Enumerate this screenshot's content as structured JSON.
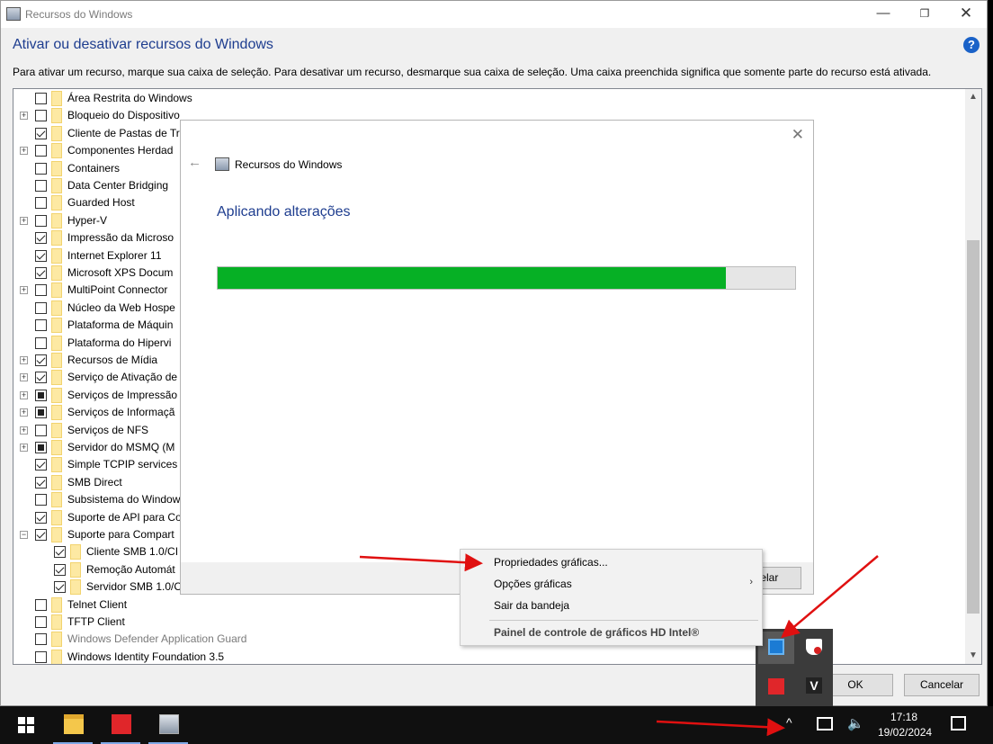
{
  "window": {
    "title": "Recursos do Windows",
    "minimize_glyph": "—",
    "maximize_glyph": "❐",
    "close_glyph": "✕"
  },
  "main": {
    "heading": "Ativar ou desativar recursos do Windows",
    "help_glyph": "?",
    "instructions": "Para ativar um recurso, marque sua caixa de seleção. Para desativar um recurso, desmarque sua caixa de seleção. Uma caixa preenchida significa que somente parte do recurso está ativada.",
    "features": [
      {
        "label": "Área Restrita do Windows",
        "state": "unchecked",
        "expandable": false,
        "indent": 0,
        "disabled": false
      },
      {
        "label": "Bloqueio do Dispositivo",
        "state": "unchecked",
        "expandable": true,
        "indent": 0,
        "disabled": false
      },
      {
        "label": "Cliente de Pastas de Tr",
        "state": "checked",
        "expandable": false,
        "indent": 0,
        "disabled": false
      },
      {
        "label": "Componentes Herdad",
        "state": "unchecked",
        "expandable": true,
        "indent": 0,
        "disabled": false
      },
      {
        "label": "Containers",
        "state": "unchecked",
        "expandable": false,
        "indent": 0,
        "disabled": false
      },
      {
        "label": "Data Center Bridging",
        "state": "unchecked",
        "expandable": false,
        "indent": 0,
        "disabled": false
      },
      {
        "label": "Guarded Host",
        "state": "unchecked",
        "expandable": false,
        "indent": 0,
        "disabled": false
      },
      {
        "label": "Hyper-V",
        "state": "unchecked",
        "expandable": true,
        "indent": 0,
        "disabled": false
      },
      {
        "label": "Impressão da Microso",
        "state": "checked",
        "expandable": false,
        "indent": 0,
        "disabled": false
      },
      {
        "label": "Internet Explorer 11",
        "state": "checked",
        "expandable": false,
        "indent": 0,
        "disabled": false
      },
      {
        "label": "Microsoft XPS Docum",
        "state": "checked",
        "expandable": false,
        "indent": 0,
        "disabled": false
      },
      {
        "label": "MultiPoint Connector",
        "state": "unchecked",
        "expandable": true,
        "indent": 0,
        "disabled": false
      },
      {
        "label": "Núcleo da Web Hospe",
        "state": "unchecked",
        "expandable": false,
        "indent": 0,
        "disabled": false
      },
      {
        "label": "Plataforma de Máquin",
        "state": "unchecked",
        "expandable": false,
        "indent": 0,
        "disabled": false
      },
      {
        "label": "Plataforma do Hipervi",
        "state": "unchecked",
        "expandable": false,
        "indent": 0,
        "disabled": false
      },
      {
        "label": "Recursos de Mídia",
        "state": "checked",
        "expandable": true,
        "indent": 0,
        "disabled": false
      },
      {
        "label": "Serviço de Ativação de",
        "state": "checked",
        "expandable": true,
        "indent": 0,
        "disabled": false
      },
      {
        "label": "Serviços de Impressão",
        "state": "partial",
        "expandable": true,
        "indent": 0,
        "disabled": false
      },
      {
        "label": "Serviços de Informaçã",
        "state": "partial",
        "expandable": true,
        "indent": 0,
        "disabled": false
      },
      {
        "label": "Serviços de NFS",
        "state": "unchecked",
        "expandable": true,
        "indent": 0,
        "disabled": false
      },
      {
        "label": "Servidor do MSMQ (M",
        "state": "partial",
        "expandable": true,
        "indent": 0,
        "disabled": false
      },
      {
        "label": "Simple TCPIP services",
        "state": "checked",
        "expandable": false,
        "indent": 0,
        "disabled": false
      },
      {
        "label": "SMB Direct",
        "state": "checked",
        "expandable": false,
        "indent": 0,
        "disabled": false
      },
      {
        "label": "Subsistema do Window",
        "state": "unchecked",
        "expandable": false,
        "indent": 0,
        "disabled": false
      },
      {
        "label": "Suporte de API para Co",
        "state": "checked",
        "expandable": false,
        "indent": 0,
        "disabled": false
      },
      {
        "label": "Suporte para Compart",
        "state": "checked",
        "expandable": true,
        "expanded": true,
        "indent": 0,
        "disabled": false
      },
      {
        "label": "Cliente SMB 1.0/CI",
        "state": "checked",
        "expandable": false,
        "indent": 1,
        "disabled": false
      },
      {
        "label": "Remoção Automát",
        "state": "checked",
        "expandable": false,
        "indent": 1,
        "disabled": false
      },
      {
        "label": "Servidor SMB 1.0/C",
        "state": "checked",
        "expandable": false,
        "indent": 1,
        "disabled": false
      },
      {
        "label": "Telnet Client",
        "state": "unchecked",
        "expandable": false,
        "indent": 0,
        "disabled": false
      },
      {
        "label": "TFTP Client",
        "state": "unchecked",
        "expandable": false,
        "indent": 0,
        "disabled": false
      },
      {
        "label": "Windows Defender Application Guard",
        "state": "unchecked",
        "expandable": false,
        "indent": 0,
        "disabled": true
      },
      {
        "label": "Windows Identity Foundation 3.5",
        "state": "unchecked",
        "expandable": false,
        "indent": 0,
        "disabled": false
      }
    ],
    "scroll_up_glyph": "▲",
    "scroll_down_glyph": "▼",
    "ok_label": "OK",
    "cancel_label": "Cancelar"
  },
  "dialog": {
    "close_glyph": "✕",
    "back_glyph": "←",
    "title": "Recursos do Windows",
    "heading": "Aplicando alterações",
    "progress_fraction": 0.88,
    "cancel_label": "ncelar"
  },
  "context_menu": {
    "items": [
      "Propriedades gráficas...",
      "Opções gráficas",
      "Sair da bandeja"
    ],
    "submenu_glyph": "›",
    "footer_label": "Painel de controle de gráficos HD Intel®"
  },
  "tray_flyout": {
    "icons": [
      "intel-graphics-icon",
      "security-shield-icon",
      "anydesk-icon",
      "veracrypt-icon"
    ],
    "v_glyph": "V"
  },
  "taskbar": {
    "apps": [
      "start-icon",
      "file-explorer-icon",
      "anydesk-icon",
      "windows-features-icon"
    ],
    "tray_chevron_glyph": "^",
    "volume_glyph": "🔈",
    "time": "17:18",
    "date": "19/02/2024"
  },
  "colors": {
    "heading_blue": "#1e3d8f",
    "progress_green": "#06b025",
    "arrow_red": "#e01010"
  }
}
